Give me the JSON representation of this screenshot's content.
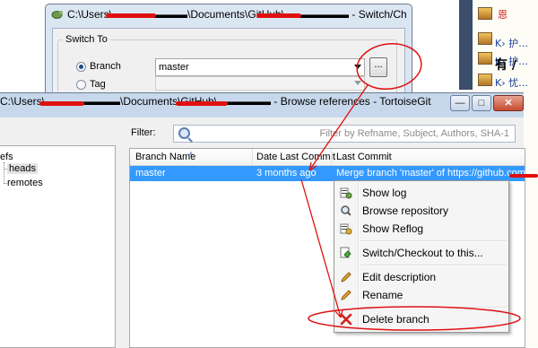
{
  "background_page": {
    "lines": [
      "恩",
      "K› 护…",
      "K› 护…",
      "有 /",
      "K› 忧…"
    ]
  },
  "switch_dialog": {
    "title": "C:\\Users\\▬▬▬▬▬▬▬\\Documents\\GitHub\\▬▬▬▬▬▬ - Switch/Checkout",
    "group_label": "Switch To",
    "branch_label": "Branch",
    "branch_value": "master",
    "tag_label": "Tag",
    "browse_label": "..."
  },
  "browse_window": {
    "title": "C:\\Users\\▬▬▬▬▬▬▬\\Documents\\GitHub\\▬▬▬▬▬ - Browse references - TortoiseGit",
    "filter_label": "Filter:",
    "filter_placeholder": "Filter by Refname, Subject, Authors, SHA-1",
    "tree": {
      "root": "efs",
      "items": [
        "heads",
        "remotes"
      ]
    },
    "columns": [
      "Branch Name",
      "Date Last Commit",
      "Last Commit"
    ],
    "rows": [
      {
        "branch": "master",
        "date": "3 months ago",
        "commit": "Merge branch 'master' of https://github.com/"
      }
    ]
  },
  "context_menu": {
    "items": [
      {
        "label": "Show log",
        "icon": "show-log-icon"
      },
      {
        "label": "Browse repository",
        "icon": "browse-repository-icon"
      },
      {
        "label": "Show Reflog",
        "icon": "reflog-icon"
      },
      {
        "label": "Switch/Checkout to this...",
        "icon": "switch-checkout-icon"
      },
      {
        "label": "Edit description",
        "icon": "pencil-icon"
      },
      {
        "label": "Rename",
        "icon": "pencil-icon"
      },
      {
        "label": "Delete branch",
        "icon": "delete-x-icon"
      }
    ]
  },
  "colors": {
    "annotation_red": "#e01010",
    "selection_blue": "#3399ff",
    "titlebar_blue": "#c7d8ec"
  }
}
